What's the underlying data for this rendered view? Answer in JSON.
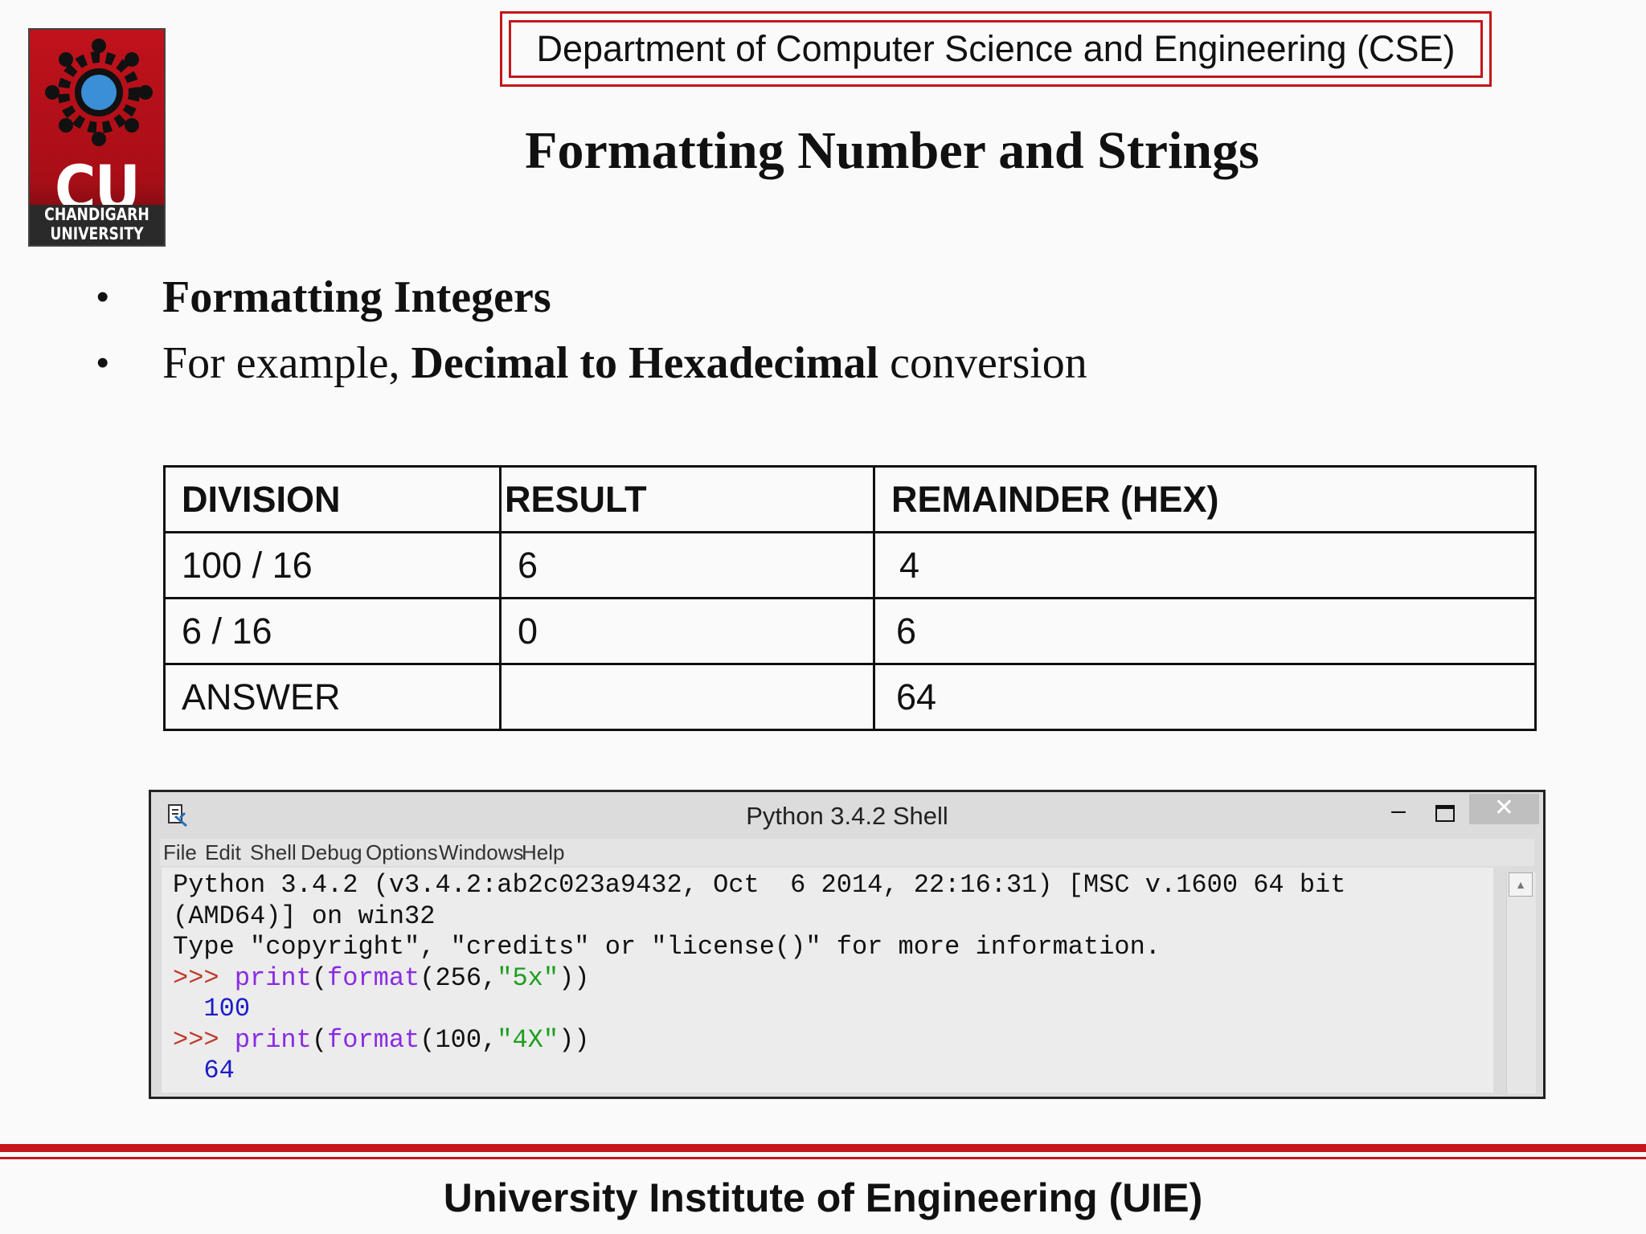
{
  "header": {
    "logo_letters": "CU",
    "logo_name_line1": "CHANDIGARH",
    "logo_name_line2": "UNIVERSITY",
    "department": "Department of Computer Science and Engineering (CSE)",
    "accent_color": "#c4161c"
  },
  "slide": {
    "title": "Formatting Number and Strings",
    "bullets": [
      {
        "text": "Formatting Integers"
      },
      {
        "prefix": "For example, ",
        "bold": "Decimal to Hexadecimal",
        "suffix": " conversion"
      }
    ]
  },
  "table": {
    "headers": [
      "DIVISION",
      "RESULT",
      "REMAINDER (HEX)"
    ],
    "rows": [
      [
        "100 / 16",
        "6",
        "4"
      ],
      [
        "6 / 16",
        "0",
        "6"
      ],
      [
        "ANSWER",
        "",
        "64"
      ]
    ]
  },
  "shell": {
    "title": "Python 3.4.2 Shell",
    "menu": [
      "File",
      "Edit",
      "Shell",
      "Debug",
      "Options",
      "Windows",
      "Help"
    ],
    "lines": {
      "l1": "Python 3.4.2 (v3.4.2:ab2c023a9432, Oct  6 2014, 22:16:31) [MSC v.1600 64 bit",
      "l2": "(AMD64)] on win32",
      "l3": "Type \"copyright\", \"credits\" or \"license()\" for more information.",
      "prompt": ">>> ",
      "cmd1_fn": "print",
      "cmd1_open": "(",
      "cmd1_fmt": "format",
      "cmd1_args_a": "(256,",
      "cmd1_str": "\"5x\"",
      "cmd1_close": "))",
      "out1": "  100",
      "cmd2_fn": "print",
      "cmd2_open": "(",
      "cmd2_fmt": "format",
      "cmd2_args_a": "(100,",
      "cmd2_str": "\"4X\"",
      "cmd2_close": "))",
      "out2": "  64"
    }
  },
  "footer": {
    "text": "University Institute of Engineering (UIE)"
  }
}
